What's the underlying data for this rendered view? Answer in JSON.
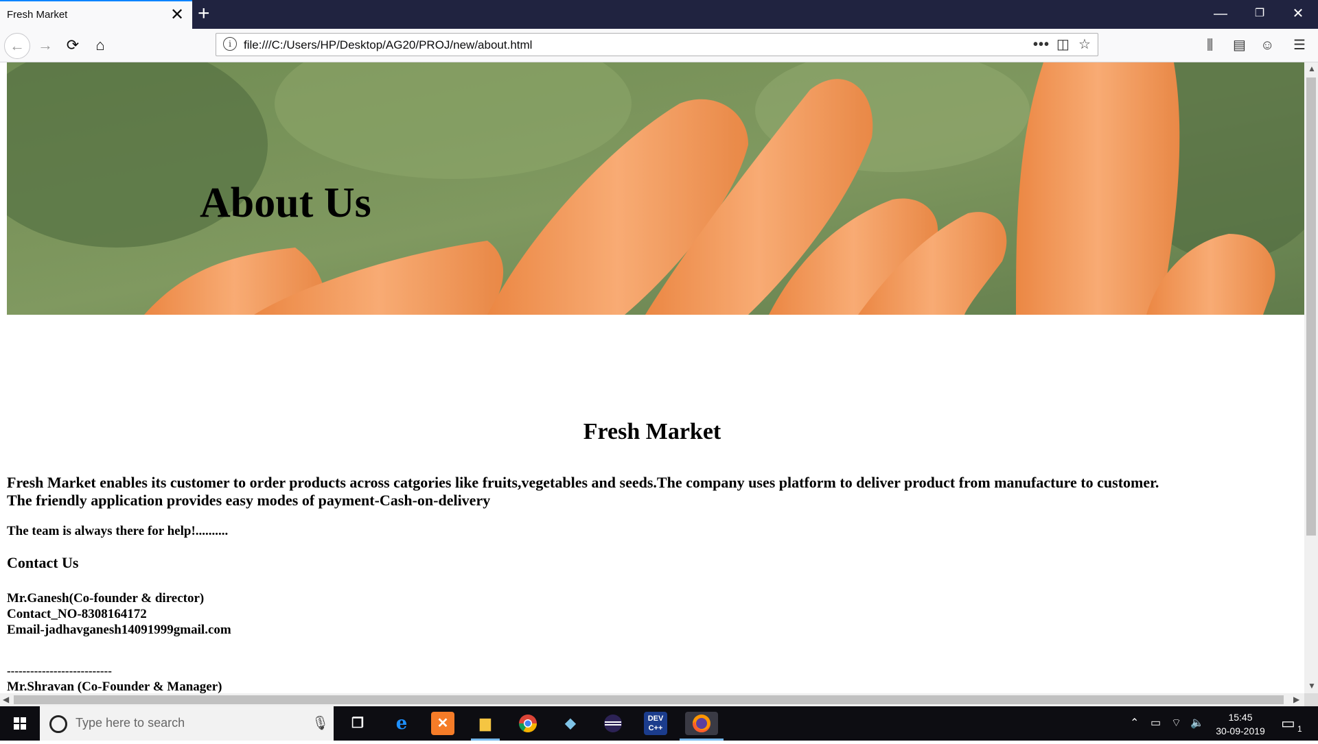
{
  "browser": {
    "tab_title": "Fresh Market",
    "tab_close": "✕",
    "new_tab": "+",
    "url": "file:///C:/Users/HP/Desktop/AG20/PROJ/new/about.html",
    "controls": {
      "minimize": "—",
      "restore": "❐",
      "close": "✕"
    }
  },
  "hero": {
    "title": "About Us"
  },
  "page": {
    "brand": "Fresh Market",
    "description_line1": "Fresh Market enables its customer to order products across catgories like fruits,vegetables and seeds.The company uses platform to deliver product from manufacture to customer.",
    "description_line2": "The friendly application provides easy modes of payment-Cash-on-delivery",
    "help_text": "The team is always there for help!..........",
    "contact_heading": "Contact Us",
    "person1_name": "Mr.Ganesh(Co-founder & director)",
    "person1_contact": "Contact_NO-8308164172",
    "person1_email": "Email-jadhavganesh14091999gmail.com",
    "separator": "---------------------------",
    "person2_partial": "Mr.Shravan (Co-Founder & Manager)"
  },
  "taskbar": {
    "search_placeholder": "Type here to search",
    "time": "15:45",
    "date": "30-09-2019",
    "notification_count": "1"
  },
  "colors": {
    "titlebar": "#202340",
    "tab_accent": "#0a84ff",
    "carrot": "#f0883c",
    "greens": "#4e6d36"
  }
}
